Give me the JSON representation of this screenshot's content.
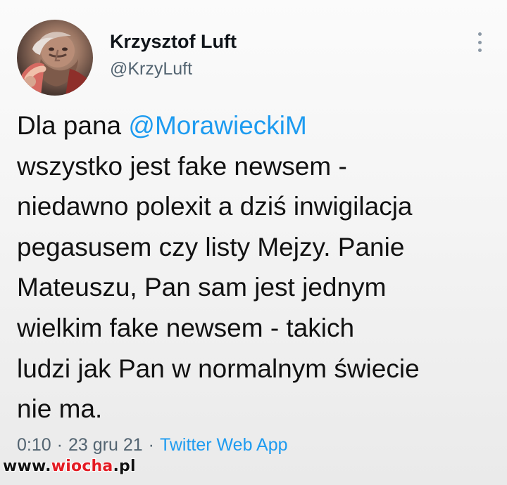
{
  "tweet": {
    "author": {
      "name": "Krzysztof Luft",
      "handle": "@KrzyLuft"
    },
    "text_lines": [
      {
        "before": "Dla pana ",
        "mention": "@MorawieckiM",
        "after": ""
      },
      {
        "text": "wszystko jest fake newsem -"
      },
      {
        "text": "niedawno polexit a dziś inwigilacja"
      },
      {
        "text": "pegasusem czy listy Mejzy. Panie"
      },
      {
        "text": "Mateuszu, Pan sam jest jednym"
      },
      {
        "text": "wielkim fake newsem - takich"
      },
      {
        "text": "ludzi jak Pan w normalnym świecie"
      },
      {
        "text": "nie ma."
      }
    ],
    "timestamp": "0:10",
    "date": "23 gru 21",
    "separator": "·",
    "source": "Twitter Web App"
  },
  "watermark": {
    "prefix": "www.",
    "brand": "wiocha",
    "suffix": ".pl"
  },
  "colors": {
    "mention": "#1d9bf0",
    "meta_gray": "#536471",
    "text": "#111111",
    "watermark_accent": "#e31b23"
  },
  "icons": {
    "menu": "more-vertical-icon"
  }
}
